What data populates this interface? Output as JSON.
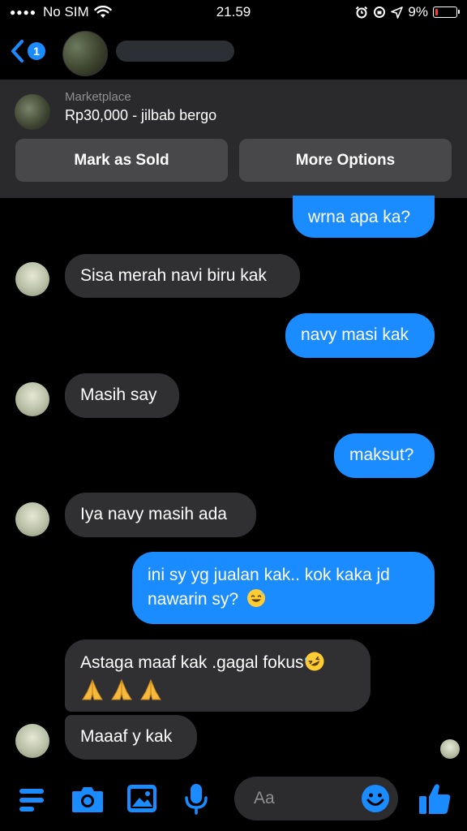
{
  "status_bar": {
    "carrier": "No SIM",
    "time": "21.59",
    "battery": "9%"
  },
  "header": {
    "unread_count": "1"
  },
  "marketplace": {
    "label": "Marketplace",
    "listing": "Rp30,000 - jilbab bergo",
    "mark_sold_label": "Mark as Sold",
    "more_options_label": "More Options"
  },
  "messages": [
    {
      "from": "me",
      "text": "wrna apa ka?"
    },
    {
      "from": "them",
      "text": "Sisa merah navi biru kak"
    },
    {
      "from": "me",
      "text": "navy masi kak"
    },
    {
      "from": "them",
      "text": "Masih say"
    },
    {
      "from": "me",
      "text": "maksut?"
    },
    {
      "from": "them",
      "text": "Iya navy masih ada"
    },
    {
      "from": "me",
      "line1": "ini sy yg jualan kak.. kok kaka jd",
      "line2": "nawarin sy?",
      "emoji": "smiling-face-with-sweat-icon"
    },
    {
      "from": "them",
      "line1": "Astaga maaf kak .gagal fokus",
      "emoji": "rolling-on-the-floor-laughing-icon",
      "line2_emoji": "folded-hands-icon x3"
    },
    {
      "from": "them",
      "text": "Maaaf y kak"
    }
  ],
  "composer": {
    "placeholder": "Aa"
  },
  "colors": {
    "accent": "#1a8cff",
    "incoming_bubble": "#303033",
    "panel": "#2a2a2c",
    "button": "#48484a"
  }
}
